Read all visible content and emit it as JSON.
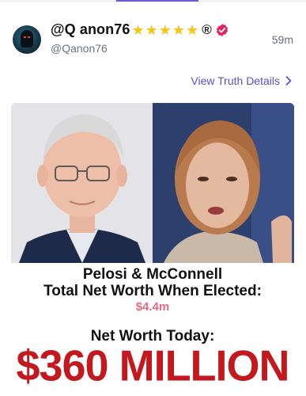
{
  "post": {
    "display_name": "@Q anon76",
    "handle": "@Qanon76",
    "timestamp": "59m",
    "star_count": 5,
    "registered_mark": "®",
    "verified_badge_color": "#e0245e",
    "details_link": "View Truth Details"
  },
  "media": {
    "headline_line1": "Pelosi & McConnell",
    "headline_line2": "Total Net Worth When Elected:",
    "elected_value": "$4.4m",
    "today_label": "Net Worth Today:",
    "today_value": "$360 MILLION"
  },
  "colors": {
    "accent": "#5a4fcf",
    "star": "#f5c518",
    "big_value": "#c3181d",
    "elected_value": "#e46a82"
  }
}
